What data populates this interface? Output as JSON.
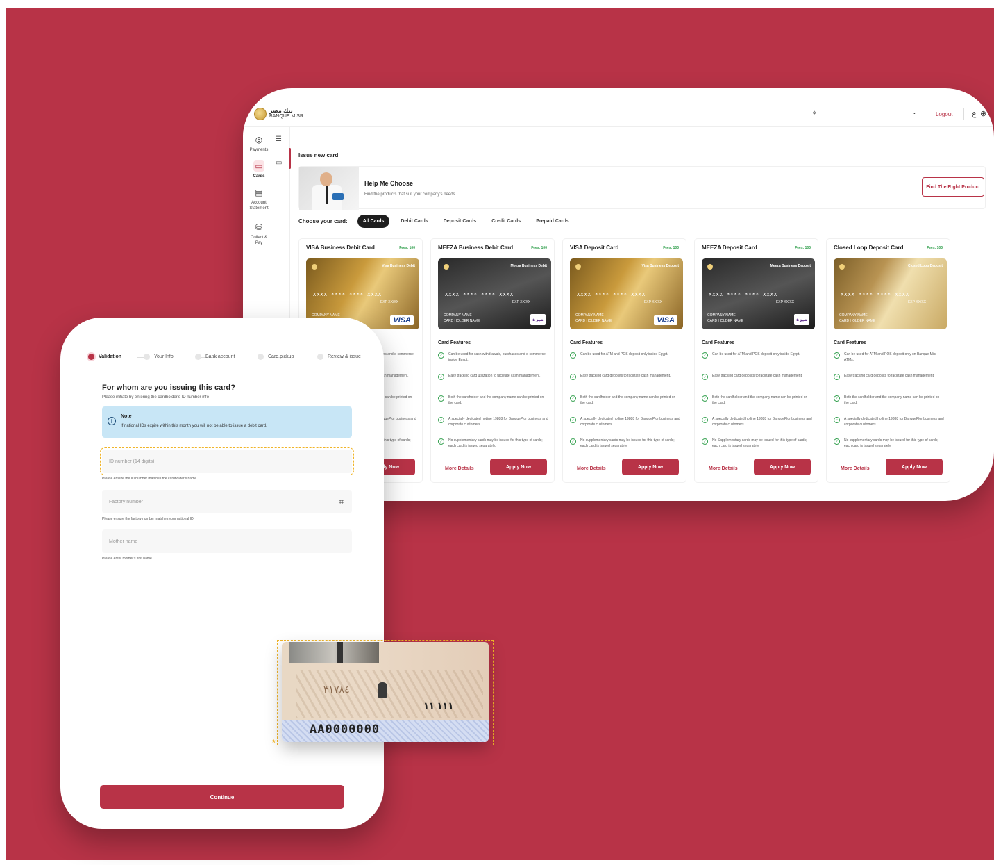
{
  "colors": {
    "background": "#b83347",
    "accent": "#b83347",
    "success": "#2e9e4a",
    "note_bg": "#c8e6f6",
    "highlight": "#f0b428"
  },
  "header": {
    "logo_ar": "بنك مصر",
    "logo_en": "BANQUE MISR",
    "logout_label": "Logout",
    "lang_label": "ع",
    "icons": [
      "pin-icon",
      "chevron-down-icon",
      "globe-icon"
    ]
  },
  "sidebar": {
    "items": [
      {
        "label": "Payments",
        "icon": "payments-icon"
      },
      {
        "label": "Cards",
        "icon": "card-icon",
        "active": true
      },
      {
        "label": "Account Statement",
        "icon": "statement-icon"
      },
      {
        "label": "Collect & Pay",
        "icon": "collect-pay-icon"
      }
    ]
  },
  "main": {
    "page_title": "Issue new card",
    "help": {
      "title": "Help Me Choose",
      "subtitle": "Find the products that suit your company's needs",
      "button": "Find The Right Product"
    },
    "choose_label": "Choose your card:",
    "filters": [
      "All Cards",
      "Debit Cards",
      "Deposit Cards",
      "Credit Cards",
      "Prepaid Cards"
    ],
    "features_title": "Card Features",
    "more_details": "More Details",
    "apply_now": "Apply Now",
    "cards": [
      {
        "title": "VISA Business Debit Card",
        "fees": "Fees: 100",
        "style": "gold",
        "card_name": "Visa Business Debit",
        "card_number": "XXXX  ****  ****  XXXX",
        "exp": "EXP XX/XX",
        "holder": "COMPANY NAME",
        "holder2": "",
        "brand": "VISA",
        "features": [
          "Can be used for cash withdrawals, purchases and e-commerce inside Egypt.",
          "Easy tracking card utilization to facilitate cash management.",
          "Both the cardholder and the company name can be printed on the card.",
          "A specially dedicated hotline 19888 for BanquePlor business and corporate customers.",
          "No supplementary cards may be issued for this type of cards; each card is issued separately."
        ]
      },
      {
        "title": "MEEZA Business Debit Card",
        "fees": "Fees: 100",
        "style": "dark",
        "card_name": "Meeza Business Debit",
        "card_number": "XXXX  ****  ****  XXXX",
        "exp": "EXP XX/XX",
        "holder": "COMPANY NAME",
        "holder2": "CARD HOLDER NAME",
        "brand": "ميزة",
        "features": [
          "Can be used for cash withdrawals, purchases and e-commerce inside Egypt.",
          "Easy tracking card utilization to facilitate cash management.",
          "Both the cardholder and the company name can be printed on the card.",
          "A specially dedicated hotline 19888 for BanquePlor business and corporate customers.",
          "No supplementary cards may be issued for this type of cards; each card is issued separately."
        ]
      },
      {
        "title": "VISA Deposit Card",
        "fees": "Fees: 100",
        "style": "gold",
        "card_name": "Visa Business Deposit",
        "card_number": "XXXX  ****  ****  XXXX",
        "exp": "EXP XX/XX",
        "holder": "COMPANY NAME",
        "holder2": "CARD HOLDER NAME",
        "brand": "VISA",
        "features": [
          "Can be used for ATM and POS deposit only inside Egypt.",
          "Easy tracking card deposits to facilitate cash management.",
          "Both the cardholder and the company name can be printed on the card.",
          "A specially dedicated hotline 19888 for BanquePlor business and corporate customers.",
          "No supplementary cards may be issued for this type of cards; each card is issued separately."
        ]
      },
      {
        "title": "MEEZA Deposit Card",
        "fees": "Fees: 100",
        "style": "dark",
        "card_name": "Meeza Business Deposit",
        "card_number": "XXXX  ****  ****  XXXX",
        "exp": "EXP XX/XX",
        "holder": "COMPANY NAME",
        "holder2": "CARD HOLDER NAME",
        "brand": "ميزة",
        "features": [
          "Can be used for ATM and POS deposit only inside Egypt.",
          "Easy tracking card deposits to facilitate cash management.",
          "Both the cardholder and the company name can be printed on the card.",
          "A specially dedicated hotline 19888 for BanquePlor business and corporate customers.",
          "No Supplementary cards may be issued for this type of cards; each card is issued separately."
        ]
      },
      {
        "title": "Closed Loop Deposit Card",
        "fees": "Fees: 100",
        "style": "light",
        "card_name": "Closed Loop Deposit",
        "card_number": "XXXX  ****  ****  XXXX",
        "exp": "EXP XX/XX",
        "holder": "COMPANY NAME",
        "holder2": "CARD HOLDER NAME",
        "brand": "",
        "features": [
          "Can be used for ATM and POS deposit only on Banque Misr ATMs.",
          "Easy tracking card deposits to facilitate cash management.",
          "Both the cardholder and the company name can be printed on the card.",
          "A specially dedicated hotline 19888 for BanquePlor business and corporate customers.",
          "No supplementary cards may be issued for this type of cards; each card is issued separately."
        ]
      }
    ]
  },
  "mobile": {
    "steps": [
      {
        "label": "Validation",
        "active": true
      },
      {
        "label": "Your Info"
      },
      {
        "label": "Bank account"
      },
      {
        "label": "Card pickup"
      },
      {
        "label": "Review & issue"
      }
    ],
    "title": "For whom are you issuing this card?",
    "subtitle": "Please initiate by entering the cardholder's ID number info",
    "note": {
      "title": "Note",
      "text": "If national IDs expire within this month you will not be able to issue a debit card."
    },
    "fields": {
      "id_placeholder": "ID number (14 digits)",
      "id_hint": "Please ensure the ID number matches the cardholder's name.",
      "factory_placeholder": "Factory number",
      "factory_hint": "Please ensure the factory number matches your national ID.",
      "mother_placeholder": "Mother name",
      "mother_hint": "Please enter mother's first name"
    },
    "continue_label": "Continue"
  },
  "id_card": {
    "number": "AA0000000",
    "arabic_number": "١١١ ١١"
  }
}
